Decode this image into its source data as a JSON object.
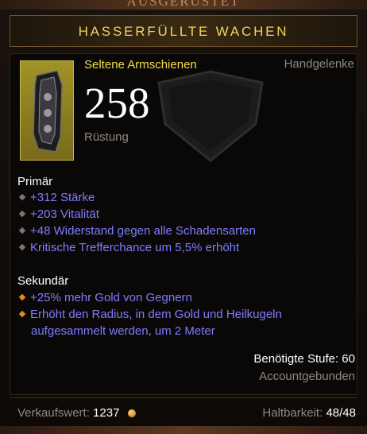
{
  "header": {
    "top_strip_text": "AUSGERÜSTET",
    "title": "HASSERFÜLLTE WACHEN"
  },
  "item": {
    "type": "Seltene Armschienen",
    "slot": "Handgelenke",
    "armor_value": "258",
    "armor_label": "Rüstung",
    "icon": "bracer-icon"
  },
  "primary": {
    "label": "Primär",
    "affixes": [
      "+312 Stärke",
      "+203 Vitalität",
      "+48 Widerstand gegen alle Schadensarten",
      "Kritische Trefferchance um 5,5% erhöht"
    ]
  },
  "secondary": {
    "label": "Sekundär",
    "affixes": [
      "+25% mehr Gold von Gegnern",
      "Erhöht den Radius, in dem Gold und Heilkugeln aufgesammelt werden, um 2 Meter"
    ]
  },
  "requirements": {
    "level": "Benötigte Stufe: 60",
    "binding": "Accountgebunden"
  },
  "footer": {
    "sell_label": "Verkaufswert:",
    "sell_value": "1237",
    "durability_label": "Haltbarkeit:",
    "durability_value": "48/48"
  },
  "colors": {
    "title_gold": "#f1d35f",
    "rare_yellow": "#f5df47",
    "affix_blue": "#7d7dff",
    "muted_grey": "#8f8880"
  }
}
